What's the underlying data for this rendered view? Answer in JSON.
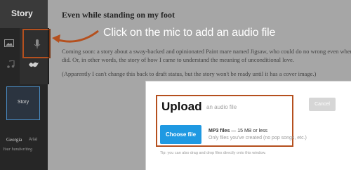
{
  "sidebar": {
    "title": "Story",
    "story_tile_label": "Story",
    "fonts": [
      "Georgia",
      "Arial"
    ],
    "handwriting_label": "Your handwriting"
  },
  "story": {
    "title": "Even while standing on my foot",
    "paragraph1_line1": "Coming soon: a story about a sway-backed and opinionated Paint mare named Jigsaw, who could do no wrong even when she",
    "paragraph1_line2": "did.  Or, in other words, the story of how I came to understand the meaning of unconditional love.",
    "paragraph2": "(Apparently I can't change this back to draft status, but the story won't be ready until it has a cover image.)"
  },
  "annotation": {
    "text": "Click on the mic to add an audio file",
    "color": "#b5501e"
  },
  "upload_dialog": {
    "title": "Upload",
    "subtitle": "an audio file",
    "cancel_label": "Cancel",
    "choose_file_label": "Choose file",
    "file_type": "MP3 files",
    "size_limit": " — 15 MB or less",
    "restriction": "Only files you've created (no pop songs, etc.)",
    "tip": "Tip: you can also drag and drop files directly onto this window."
  },
  "colors": {
    "accent_orange": "#b5501e",
    "button_blue": "#1f99e2"
  },
  "icons": [
    "picture-icon",
    "microphone-icon",
    "music-note-icon",
    "bird-icon"
  ]
}
